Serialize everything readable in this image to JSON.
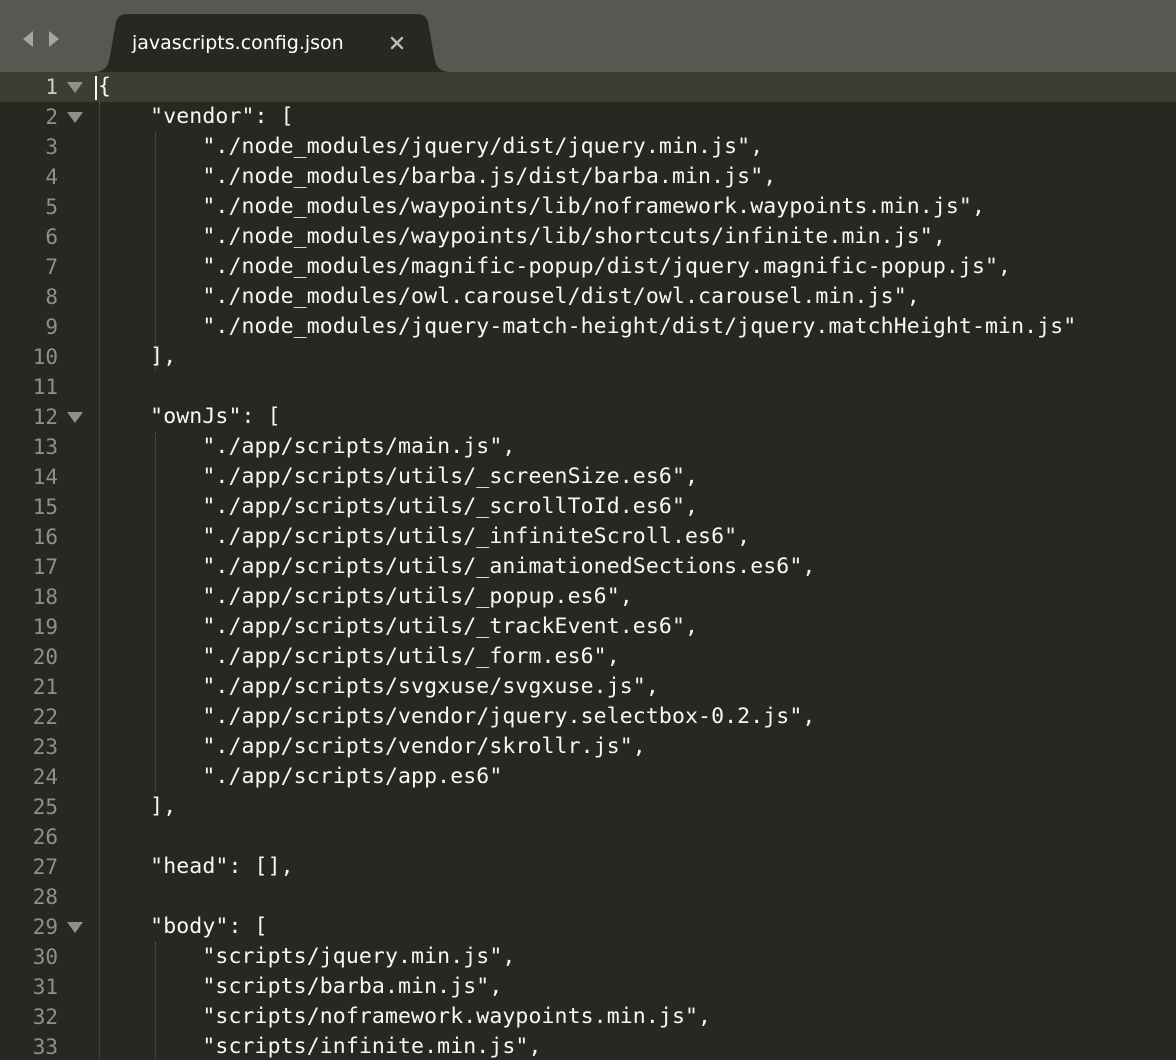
{
  "window": {
    "nav": {
      "back_icon": "back-arrow-icon",
      "forward_icon": "forward-arrow-icon"
    },
    "tab": {
      "title": "javascripts.config.json",
      "close_icon": "close-icon"
    }
  },
  "colors": {
    "background": "#272822",
    "tabbar": "#575851",
    "active_line": "#3e3d32",
    "text": "#f8f8f2",
    "gutter": "#8f908a"
  },
  "editor": {
    "current_line": 1,
    "lines": [
      {
        "number": "1",
        "text": "{",
        "fold": true
      },
      {
        "number": "2",
        "text": "    \"vendor\": [",
        "fold": true
      },
      {
        "number": "3",
        "text": "        \"./node_modules/jquery/dist/jquery.min.js\",",
        "fold": false
      },
      {
        "number": "4",
        "text": "        \"./node_modules/barba.js/dist/barba.min.js\",",
        "fold": false
      },
      {
        "number": "5",
        "text": "        \"./node_modules/waypoints/lib/noframework.waypoints.min.js\",",
        "fold": false
      },
      {
        "number": "6",
        "text": "        \"./node_modules/waypoints/lib/shortcuts/infinite.min.js\",",
        "fold": false
      },
      {
        "number": "7",
        "text": "        \"./node_modules/magnific-popup/dist/jquery.magnific-popup.js\",",
        "fold": false
      },
      {
        "number": "8",
        "text": "        \"./node_modules/owl.carousel/dist/owl.carousel.min.js\",",
        "fold": false
      },
      {
        "number": "9",
        "text": "        \"./node_modules/jquery-match-height/dist/jquery.matchHeight-min.js\"",
        "fold": false
      },
      {
        "number": "10",
        "text": "    ],",
        "fold": false
      },
      {
        "number": "11",
        "text": "",
        "fold": false
      },
      {
        "number": "12",
        "text": "    \"ownJs\": [",
        "fold": true
      },
      {
        "number": "13",
        "text": "        \"./app/scripts/main.js\",",
        "fold": false
      },
      {
        "number": "14",
        "text": "        \"./app/scripts/utils/_screenSize.es6\",",
        "fold": false
      },
      {
        "number": "15",
        "text": "        \"./app/scripts/utils/_scrollToId.es6\",",
        "fold": false
      },
      {
        "number": "16",
        "text": "        \"./app/scripts/utils/_infiniteScroll.es6\",",
        "fold": false
      },
      {
        "number": "17",
        "text": "        \"./app/scripts/utils/_animationedSections.es6\",",
        "fold": false
      },
      {
        "number": "18",
        "text": "        \"./app/scripts/utils/_popup.es6\",",
        "fold": false
      },
      {
        "number": "19",
        "text": "        \"./app/scripts/utils/_trackEvent.es6\",",
        "fold": false
      },
      {
        "number": "20",
        "text": "        \"./app/scripts/utils/_form.es6\",",
        "fold": false
      },
      {
        "number": "21",
        "text": "        \"./app/scripts/svgxuse/svgxuse.js\",",
        "fold": false
      },
      {
        "number": "22",
        "text": "        \"./app/scripts/vendor/jquery.selectbox-0.2.js\",",
        "fold": false
      },
      {
        "number": "23",
        "text": "        \"./app/scripts/vendor/skrollr.js\",",
        "fold": false
      },
      {
        "number": "24",
        "text": "        \"./app/scripts/app.es6\"",
        "fold": false
      },
      {
        "number": "25",
        "text": "    ],",
        "fold": false
      },
      {
        "number": "26",
        "text": "",
        "fold": false
      },
      {
        "number": "27",
        "text": "    \"head\": [],",
        "fold": false
      },
      {
        "number": "28",
        "text": "",
        "fold": false
      },
      {
        "number": "29",
        "text": "    \"body\": [",
        "fold": true
      },
      {
        "number": "30",
        "text": "        \"scripts/jquery.min.js\",",
        "fold": false
      },
      {
        "number": "31",
        "text": "        \"scripts/barba.min.js\",",
        "fold": false
      },
      {
        "number": "32",
        "text": "        \"scripts/noframework.waypoints.min.js\",",
        "fold": false
      },
      {
        "number": "33",
        "text": "        \"scripts/infinite.min.js\",",
        "fold": false
      }
    ]
  }
}
